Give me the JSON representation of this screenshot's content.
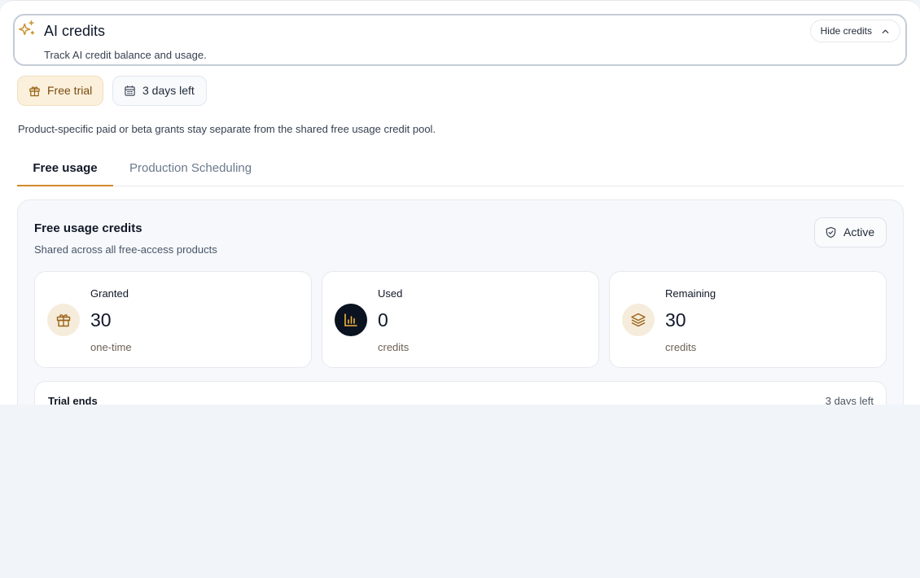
{
  "header": {
    "title": "AI credits",
    "subtitle": "Track AI credit balance and usage.",
    "hide_label": "Hide credits",
    "icon": "sparkles-icon"
  },
  "chips": {
    "trial_label": "Free trial",
    "days_label": "3 days left"
  },
  "description": "Product-specific paid or beta grants stay separate from the shared free usage credit pool.",
  "tabs": [
    {
      "label": "Free usage",
      "active": true
    },
    {
      "label": "Production Scheduling",
      "active": false
    }
  ],
  "card": {
    "title": "Free usage credits",
    "subtitle": "Shared across all free-access products",
    "status": "Active",
    "stats": [
      {
        "label": "Granted",
        "value": "30",
        "unit": "one-time",
        "icon": "gift-icon"
      },
      {
        "label": "Used",
        "value": "0",
        "unit": "credits",
        "icon": "bar-chart-icon"
      },
      {
        "label": "Remaining",
        "value": "30",
        "unit": "credits",
        "icon": "layers-icon"
      }
    ],
    "trial": {
      "label": "Trial ends",
      "value": "3 days left"
    }
  },
  "colors": {
    "accent": "#d18a2a",
    "trial_chip_bg": "#fbf0dc",
    "page_bg": "#f1f4f8"
  }
}
